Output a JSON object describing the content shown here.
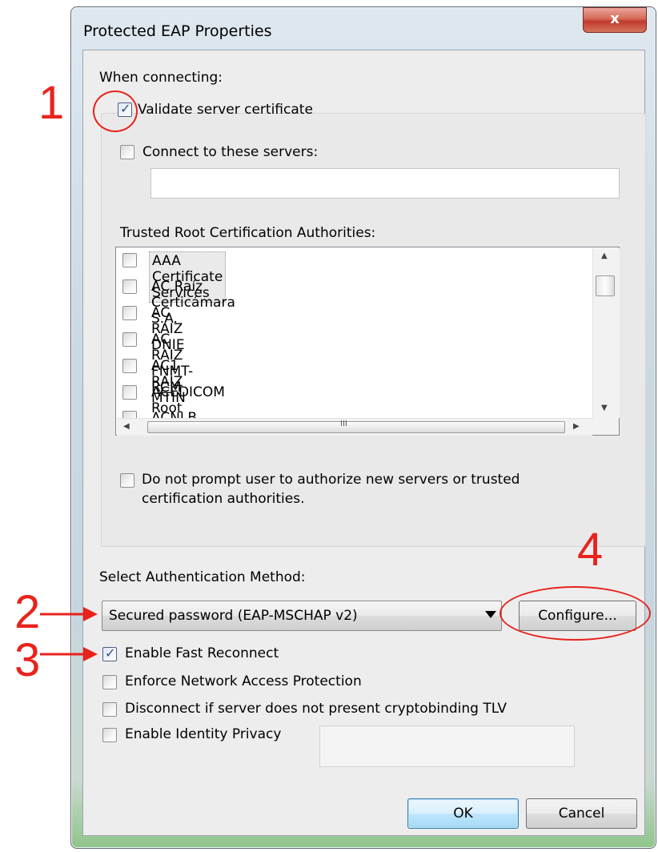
{
  "window": {
    "title": "Protected EAP Properties",
    "close_glyph": "x"
  },
  "when_connecting": {
    "label": "When connecting:",
    "validate_server_certificate": {
      "label": "Validate server certificate",
      "checked": true
    },
    "connect_to_servers": {
      "label": "Connect to these servers:",
      "checked": false,
      "value": ""
    },
    "trusted_root_label": "Trusted Root Certification Authorities:",
    "cas": [
      {
        "name": "AAA Certificate Services",
        "checked": false
      },
      {
        "name": "AC Raíz Certicámara S.A.",
        "checked": false
      },
      {
        "name": "AC RAIZ DNIE",
        "checked": false
      },
      {
        "name": "AC RAIZ FNMT-RCM",
        "checked": false
      },
      {
        "name": "AC1 RAIZ MTIN",
        "checked": false
      },
      {
        "name": "ACEDICOM Root",
        "checked": false
      },
      {
        "name": "ACNLB",
        "checked": false
      }
    ],
    "hscroll_grip": "III",
    "do_not_prompt": {
      "label_line1": "Do not prompt user to authorize new servers or trusted",
      "label_line2": "certification authorities.",
      "checked": false
    }
  },
  "auth": {
    "label": "Select Authentication Method:",
    "method_value": "Secured password (EAP-MSCHAP v2)",
    "configure_label": "Configure..."
  },
  "options": {
    "fast_reconnect": {
      "label": "Enable Fast Reconnect",
      "checked": true
    },
    "nap": {
      "label": "Enforce Network Access Protection",
      "checked": false
    },
    "cryptobinding": {
      "label": "Disconnect if server does not present cryptobinding TLV",
      "checked": false
    },
    "identity_privacy": {
      "label": "Enable Identity Privacy",
      "checked": false,
      "value": ""
    }
  },
  "buttons": {
    "ok": "OK",
    "cancel": "Cancel"
  },
  "annotations": {
    "n1": "1",
    "n2": "2",
    "n3": "3",
    "n4": "4",
    "color": "#e8231c"
  }
}
